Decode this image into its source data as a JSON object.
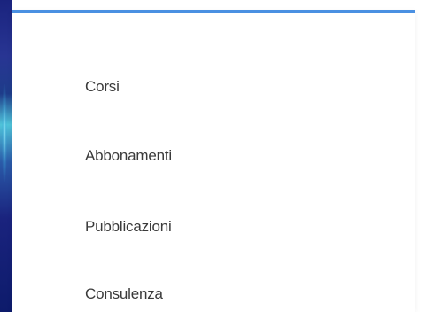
{
  "menu": {
    "items": [
      {
        "label": "Corsi"
      },
      {
        "label": "Abbonamenti"
      },
      {
        "label": "Pubblicazioni"
      },
      {
        "label": "Consulenza"
      }
    ]
  },
  "colors": {
    "accent_border": "#4a90e2",
    "text": "#3a3a3a",
    "side_strip": "#1a237e"
  }
}
